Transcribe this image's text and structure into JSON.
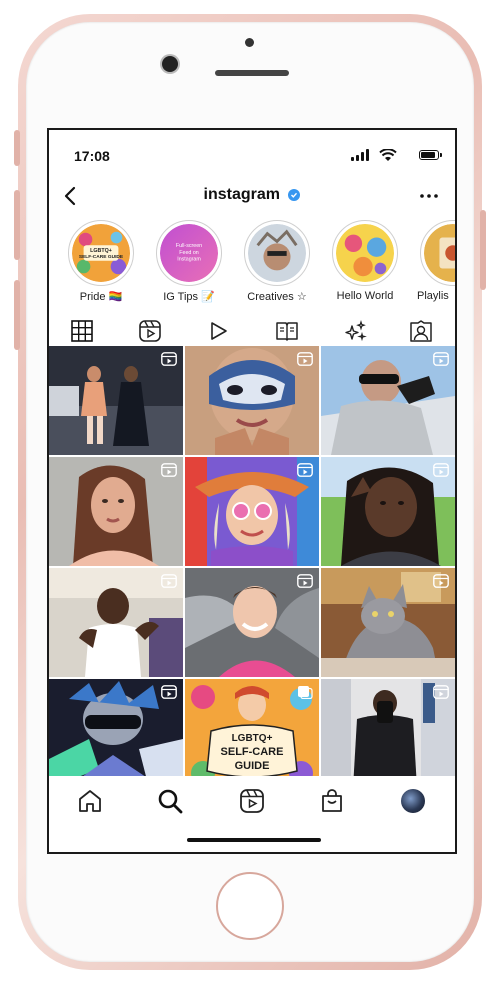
{
  "status_bar": {
    "time": "17:08",
    "icons": [
      "signal-icon",
      "wifi-icon",
      "battery-icon"
    ]
  },
  "header": {
    "title": "instagram",
    "verified_icon": "verified-badge-icon",
    "back_icon": "back-chevron-icon",
    "more_icon": "more-dots-icon"
  },
  "highlights": [
    {
      "label": "Pride 🏳️‍🌈"
    },
    {
      "label": "IG Tips 📝"
    },
    {
      "label": "Creatives ☆"
    },
    {
      "label": "Hello World"
    },
    {
      "label": "Playlis"
    }
  ],
  "highlight_texts": {
    "pride_cover": "LGBTQ+ SELF-CARE GUIDE",
    "tips_cover": "Full-screen Feed on Instagram"
  },
  "tabs": [
    {
      "name": "grid-tab",
      "icon": "grid-icon",
      "active": true
    },
    {
      "name": "reels-tab",
      "icon": "reels-icon"
    },
    {
      "name": "videos-tab",
      "icon": "play-icon"
    },
    {
      "name": "guides-tab",
      "icon": "book-icon"
    },
    {
      "name": "effects-tab",
      "icon": "sparkles-icon"
    },
    {
      "name": "tagged-tab",
      "icon": "tagged-person-icon"
    }
  ],
  "grid_cells": [
    {
      "description_icon": "reel-icon"
    },
    {
      "description_icon": "reel-icon"
    },
    {
      "description_icon": "reel-icon"
    },
    {
      "description_icon": "reel-icon"
    },
    {
      "description_icon": "reel-icon"
    },
    {
      "description_icon": "reel-icon"
    },
    {
      "description_icon": "reel-icon"
    },
    {
      "description_icon": "reel-icon"
    },
    {
      "description_icon": "reel-icon"
    },
    {
      "description_icon": "reel-icon"
    },
    {
      "description_icon": "carousel-icon"
    },
    {
      "description_icon": "reel-icon"
    }
  ],
  "grid_texts": {
    "guide_cover": "LGBTQ+ SELF-CARE GUIDE"
  },
  "bottom_nav": [
    {
      "icon": "home-icon"
    },
    {
      "icon": "search-icon"
    },
    {
      "icon": "reels-icon"
    },
    {
      "icon": "shop-icon"
    },
    {
      "icon": "profile-avatar-icon"
    }
  ],
  "colors": {
    "verified": "#3897f0",
    "phone_frame": "#e9bdb4",
    "text": "#111111"
  }
}
